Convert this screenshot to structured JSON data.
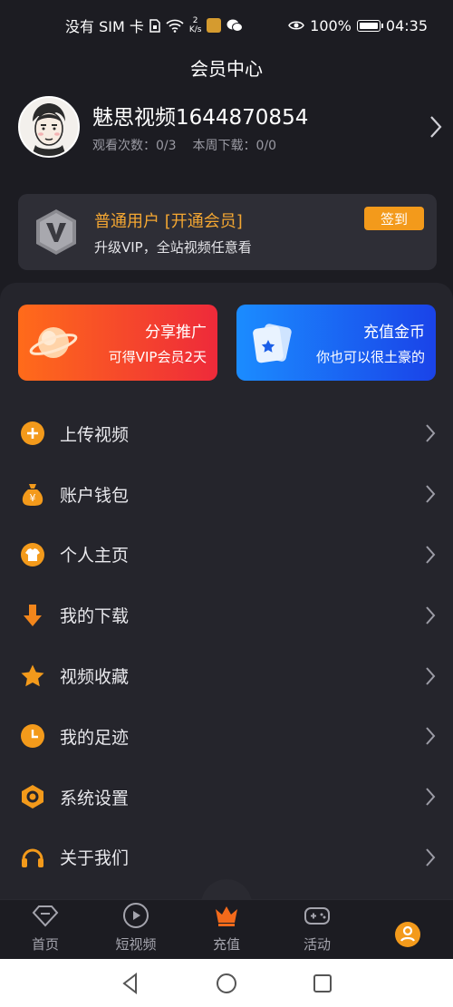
{
  "status_bar": {
    "carrier": "没有 SIM 卡",
    "speed_top": "2",
    "speed_bottom": "K/s",
    "battery": "100%",
    "time": "04:35"
  },
  "header": {
    "title": "会员中心"
  },
  "profile": {
    "name": "魅思视频1644870854",
    "views": "观看次数：0/3",
    "downloads": "本周下载：0/0"
  },
  "vip_card": {
    "title": "普通用户 [开通会员]",
    "subtitle": "升级VIP，全站视频任意看",
    "sign_label": "签到"
  },
  "promos": [
    {
      "title": "分享推广",
      "subtitle": "可得VIP会员2天"
    },
    {
      "title": "充值金币",
      "subtitle": "你也可以很土豪的"
    }
  ],
  "menu": [
    {
      "label": "上传视频",
      "icon": "plus-circle-icon"
    },
    {
      "label": "账户钱包",
      "icon": "money-bag-icon"
    },
    {
      "label": "个人主页",
      "icon": "shirt-icon"
    },
    {
      "label": "我的下载",
      "icon": "download-arrow-icon"
    },
    {
      "label": "视频收藏",
      "icon": "star-icon"
    },
    {
      "label": "我的足迹",
      "icon": "clock-icon"
    },
    {
      "label": "系统设置",
      "icon": "hexagon-settings-icon"
    },
    {
      "label": "关于我们",
      "icon": "headset-icon"
    }
  ],
  "bottom_nav": [
    {
      "label": "首页",
      "icon": "diamond-icon"
    },
    {
      "label": "短视频",
      "icon": "play-icon"
    },
    {
      "label": "充值",
      "icon": "crown-icon"
    },
    {
      "label": "活动",
      "icon": "gamepad-icon"
    },
    {
      "label": "",
      "icon": "user-icon",
      "active": true
    }
  ],
  "colors": {
    "accent": "#f39a1b",
    "background": "#1c1c22",
    "panel": "#25252c"
  }
}
